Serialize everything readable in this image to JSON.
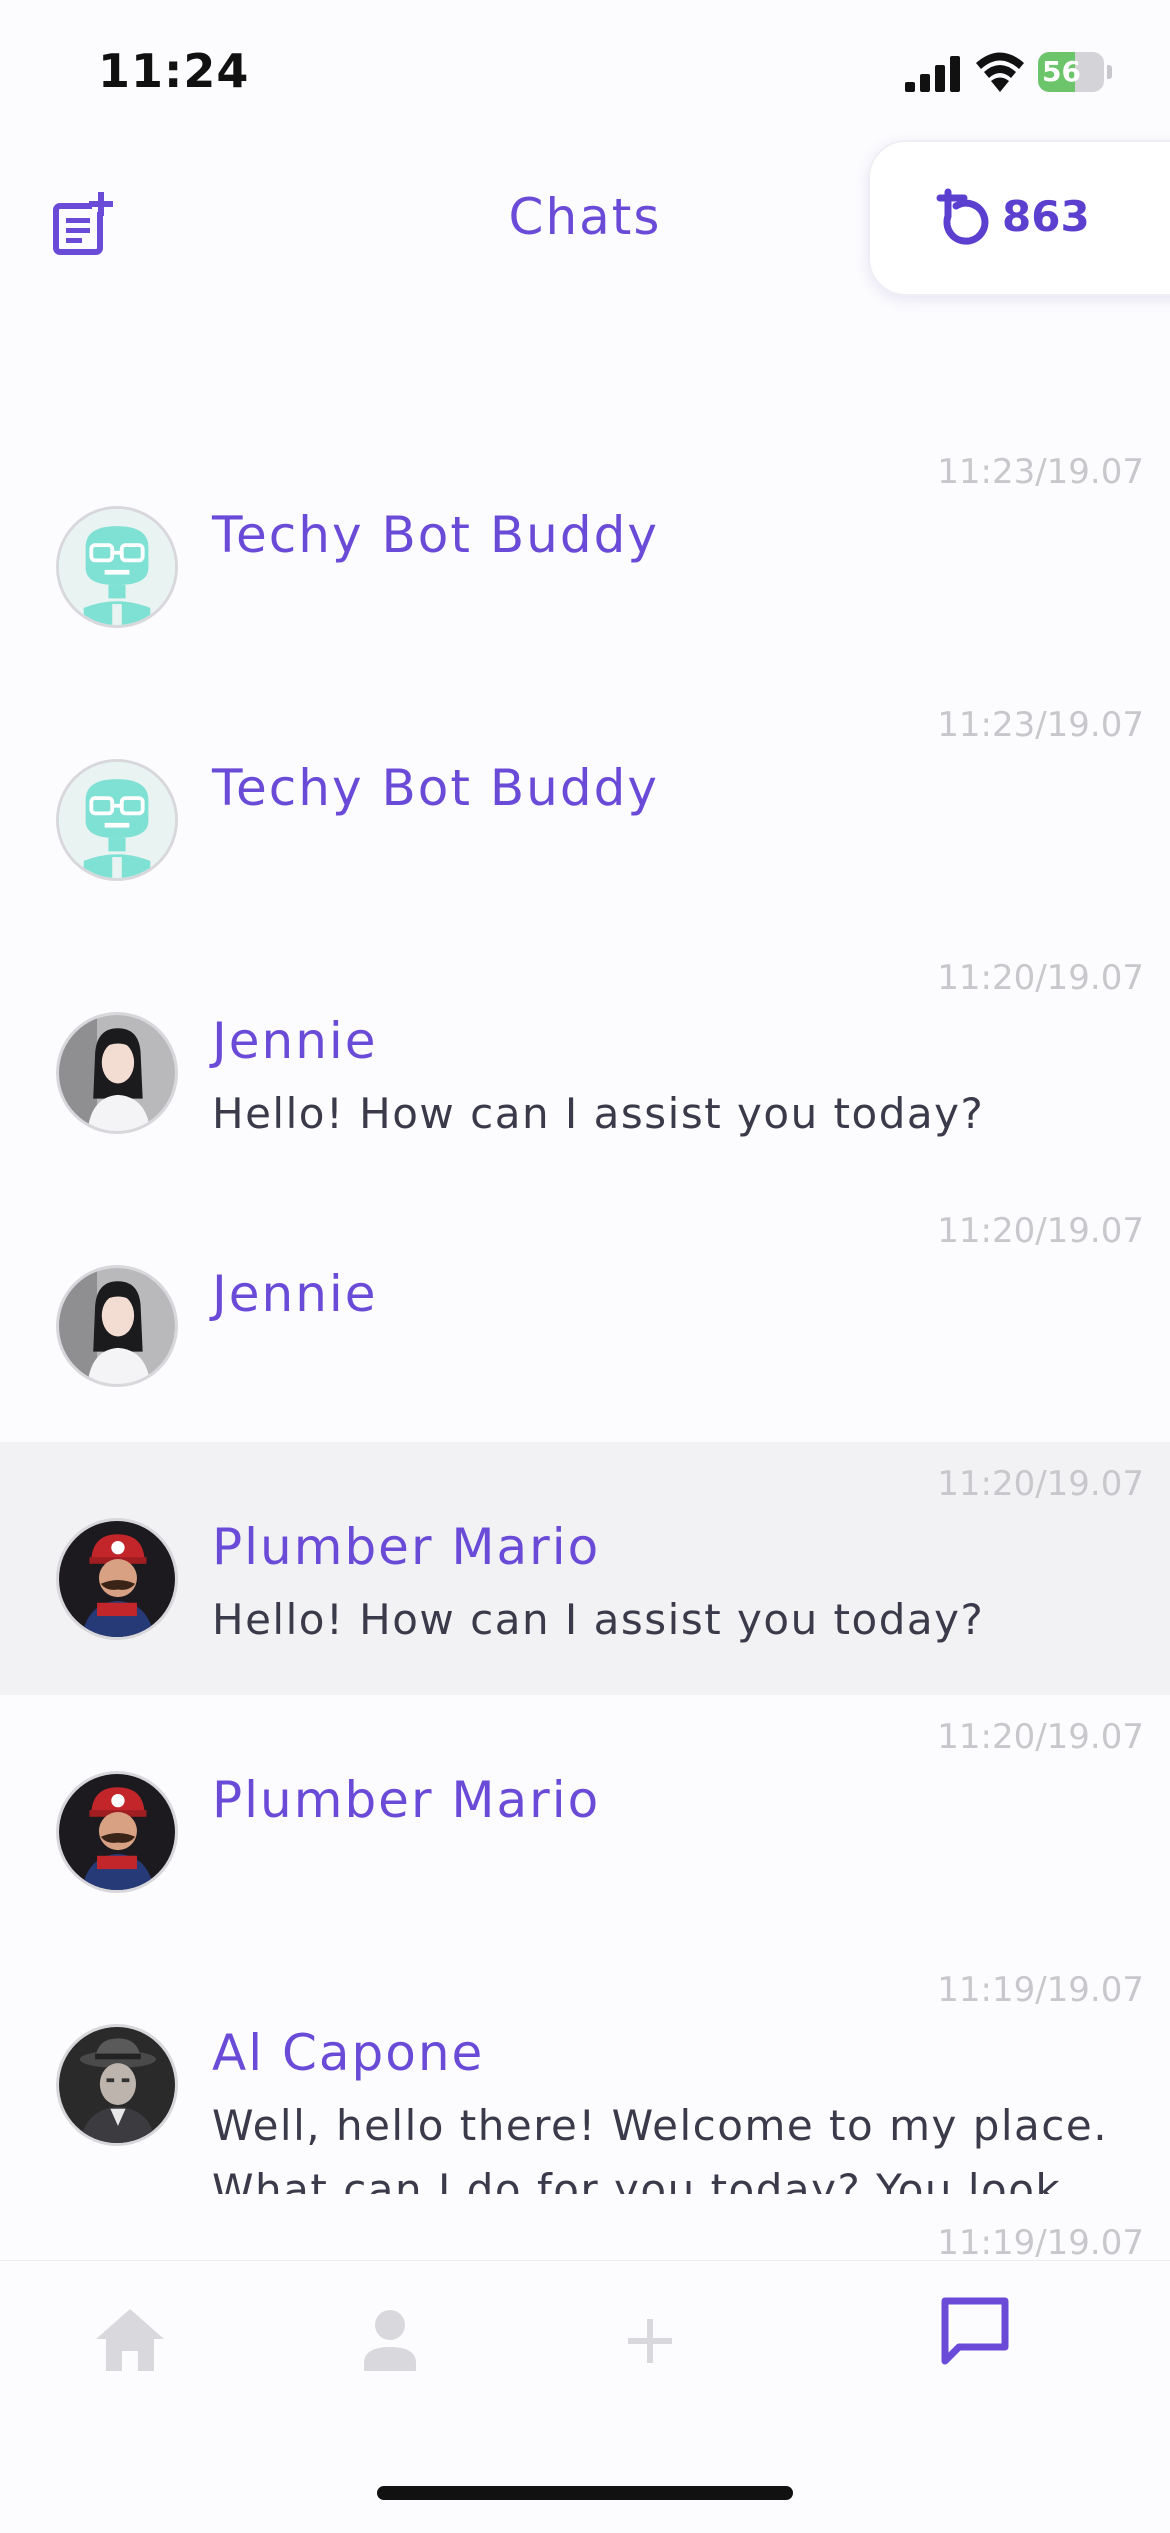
{
  "status_bar": {
    "time": "11:24",
    "battery_percent": "56",
    "battery_level": 0.56,
    "icons": [
      "signal-icon",
      "wifi-icon",
      "battery-icon"
    ]
  },
  "header": {
    "title": "Chats",
    "credits": "863",
    "new_chat_icon": "new-note-icon",
    "credits_icon": "credits-coin-icon"
  },
  "chats": [
    {
      "name": "Techy Bot Buddy",
      "preview": "",
      "time": "11:23/19.07",
      "avatar": "robot-avatar"
    },
    {
      "name": "Techy Bot Buddy",
      "preview": "",
      "time": "11:23/19.07",
      "avatar": "robot-avatar"
    },
    {
      "name": "Jennie",
      "preview": "Hello! How can I assist you today?",
      "time": "11:20/19.07",
      "avatar": "woman-avatar"
    },
    {
      "name": "Jennie",
      "preview": "",
      "time": "11:20/19.07",
      "avatar": "woman-avatar"
    },
    {
      "name": "Plumber Mario",
      "preview": "Hello! How can I assist you today?",
      "time": "11:20/19.07",
      "avatar": "mario-avatar",
      "active": true
    },
    {
      "name": "Plumber Mario",
      "preview": "",
      "time": "11:20/19.07",
      "avatar": "mario-avatar"
    },
    {
      "name": "Al Capone",
      "preview": "Well, hello there! Welcome to my place. What can I do for you today? You look",
      "time": "11:19/19.07",
      "avatar": "gangster-avatar"
    },
    {
      "name": "",
      "preview": "",
      "time": "11:19/19.07",
      "avatar": ""
    }
  ],
  "tabs": [
    {
      "name": "home",
      "icon": "home-icon"
    },
    {
      "name": "profile",
      "icon": "person-icon"
    },
    {
      "name": "create",
      "icon": "plus-icon"
    },
    {
      "name": "chats",
      "icon": "chat-bubble-icon",
      "active": true
    }
  ],
  "colors": {
    "accent": "#6a4bd8",
    "text": "#3a3a4a",
    "timestamp": "#c8c8cc",
    "active_row": "#f2f2f4",
    "inactive_tab": "#d9d9dd"
  }
}
